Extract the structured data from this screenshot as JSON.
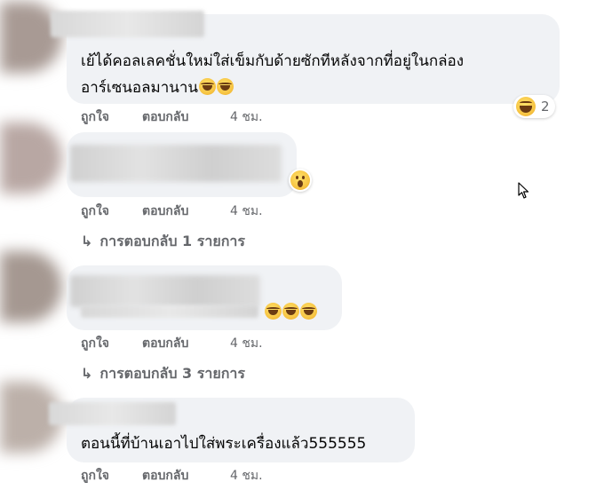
{
  "comments": [
    {
      "text_lines": [
        "เย้ได้คอลเลคชั่นใหม่ใส่เข็มกับด้ายซักทีหลังจากที่อยู่ในกล่อง",
        "อาร์เซนอลมานาน"
      ],
      "emoji_icon": "rofl-emoji-icon",
      "reaction": {
        "icon": "haha-reaction-icon",
        "count": "2"
      },
      "actions": {
        "like": "ถูกใจ",
        "reply": "ตอบกลับ",
        "time": "4 ชม."
      }
    },
    {
      "reaction": {
        "icon": "wow-reaction-icon"
      },
      "actions": {
        "like": "ถูกใจ",
        "reply": "ตอบกลับ",
        "time": "4 ชม."
      },
      "replies_label": "การตอบกลับ 1 รายการ"
    },
    {
      "emoji_icon": "rofl-emoji-icon",
      "actions": {
        "like": "ถูกใจ",
        "reply": "ตอบกลับ",
        "time": "4 ชม."
      },
      "replies_label": "การตอบกลับ 3 รายการ"
    },
    {
      "text_lines": [
        "ตอนนี้ที่บ้านเอาไปใส่พระเครื่องแล้ว555555"
      ],
      "actions": {
        "like": "ถูกใจ",
        "reply": "ตอบกลับ",
        "time": "4 ชม."
      }
    }
  ],
  "colors": {
    "bubble": "#f0f2f5",
    "secondary_text": "#65676b",
    "primary_text": "#050505"
  }
}
